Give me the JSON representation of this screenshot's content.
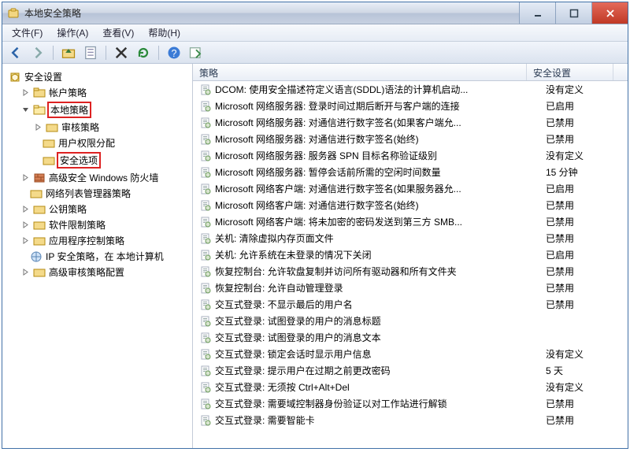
{
  "window": {
    "title": "本地安全策略"
  },
  "menu": {
    "file": "文件(F)",
    "action": "操作(A)",
    "view": "查看(V)",
    "help": "帮助(H)"
  },
  "toolbar_icons": {
    "back": "back-icon",
    "forward": "forward-icon",
    "up": "up-icon",
    "props": "properties-icon",
    "delete": "delete-icon",
    "refresh": "refresh-icon",
    "help": "help-icon",
    "export": "export-icon"
  },
  "columns": {
    "policy": "策略",
    "setting": "安全设置"
  },
  "tree": {
    "root": "安全设置",
    "account": "帐户策略",
    "local": "本地策略",
    "audit": "审核策略",
    "user_rights": "用户权限分配",
    "security_options": "安全选项",
    "firewall": "高级安全 Windows 防火墙",
    "netlist": "网络列表管理器策略",
    "pubkey": "公钥策略",
    "software_restrict": "软件限制策略",
    "app_control": "应用程序控制策略",
    "ipsec": "IP 安全策略，在 本地计算机",
    "adv_audit": "高级审核策略配置"
  },
  "policies": [
    {
      "name": "DCOM: 使用安全描述符定义语言(SDDL)语法的计算机启动...",
      "setting": "没有定义"
    },
    {
      "name": "Microsoft 网络服务器: 登录时间过期后断开与客户端的连接",
      "setting": "已启用"
    },
    {
      "name": "Microsoft 网络服务器: 对通信进行数字签名(如果客户端允...",
      "setting": "已禁用"
    },
    {
      "name": "Microsoft 网络服务器: 对通信进行数字签名(始终)",
      "setting": "已禁用"
    },
    {
      "name": "Microsoft 网络服务器: 服务器 SPN 目标名称验证级别",
      "setting": "没有定义"
    },
    {
      "name": "Microsoft 网络服务器: 暂停会话前所需的空闲时间数量",
      "setting": "15 分钟"
    },
    {
      "name": "Microsoft 网络客户端: 对通信进行数字签名(如果服务器允...",
      "setting": "已启用"
    },
    {
      "name": "Microsoft 网络客户端: 对通信进行数字签名(始终)",
      "setting": "已禁用"
    },
    {
      "name": "Microsoft 网络客户端: 将未加密的密码发送到第三方 SMB...",
      "setting": "已禁用"
    },
    {
      "name": "关机: 清除虚拟内存页面文件",
      "setting": "已禁用"
    },
    {
      "name": "关机: 允许系统在未登录的情况下关闭",
      "setting": "已启用"
    },
    {
      "name": "恢复控制台: 允许软盘复制并访问所有驱动器和所有文件夹",
      "setting": "已禁用"
    },
    {
      "name": "恢复控制台: 允许自动管理登录",
      "setting": "已禁用"
    },
    {
      "name": "交互式登录: 不显示最后的用户名",
      "setting": "已禁用"
    },
    {
      "name": "交互式登录: 试图登录的用户的消息标题",
      "setting": ""
    },
    {
      "name": "交互式登录: 试图登录的用户的消息文本",
      "setting": ""
    },
    {
      "name": "交互式登录: 锁定会话时显示用户信息",
      "setting": "没有定义"
    },
    {
      "name": "交互式登录: 提示用户在过期之前更改密码",
      "setting": "5 天"
    },
    {
      "name": "交互式登录: 无须按 Ctrl+Alt+Del",
      "setting": "没有定义"
    },
    {
      "name": "交互式登录: 需要域控制器身份验证以对工作站进行解锁",
      "setting": "已禁用"
    },
    {
      "name": "交互式登录: 需要智能卡",
      "setting": "已禁用"
    }
  ]
}
